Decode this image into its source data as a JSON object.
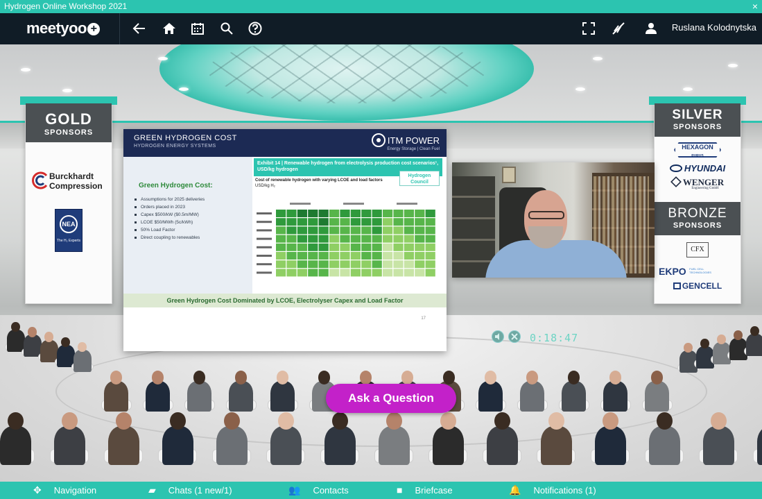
{
  "window": {
    "title": "Hydrogen Online Workshop 2021",
    "close_glyph": "×"
  },
  "nav": {
    "brand": "meetyoo",
    "brand_plus": "+",
    "icons": [
      "back-arrow-icon",
      "home-icon",
      "calendar-icon",
      "search-icon",
      "help-icon",
      "fullscreen-icon",
      "mute-icon",
      "user-icon"
    ],
    "user_name": "Ruslana Kolodnytska"
  },
  "gold_banner": {
    "title": "GOLD",
    "subtitle": "SPONSORS",
    "logos": [
      "Burckhardt",
      "Compression",
      "NEA"
    ],
    "nea_sub": "The H₂ Experts"
  },
  "silver_banner": {
    "title": "SILVER",
    "subtitle": "SPONSORS",
    "logos": [
      "HEXAGON",
      "PURUS",
      "HYUNDAI",
      "WENGER",
      "Engineering GmbH"
    ]
  },
  "bronze_banner": {
    "title": "BRONZE",
    "subtitle": "SPONSORS",
    "logos": [
      "CFX",
      "EKPO",
      "FUEL CELL TECHNOLOGIES",
      "GENCELL"
    ]
  },
  "slide": {
    "title": "GREEN HYDROGEN COST",
    "subtitle": "HYDROGEN ENERGY SYSTEMS",
    "logo": "ITM POWER",
    "logo_sub": "Energy Storage | Clean Fuel",
    "left_title": "Green Hydrogen Cost:",
    "bullets": [
      "Assumptions for 2025 deliveries",
      "Orders placed in 2023",
      "Capex $500/kW ($0.5m/MW)",
      "LCOE $50/MWh (5c/kWh)",
      "50% Load Factor",
      "Direct coupling to renewables"
    ],
    "exhibit": "Exhibit 14 | Renewable hydrogen from electrolysis production cost scenarios¹, USD/kg hydrogen",
    "badge_line1": "Hydrogen",
    "badge_line2": "Council",
    "table_caption": "Cost of renewable hydrogen with varying LCOE and load factors",
    "table_unit": "USD/kg H₂",
    "footer": "Green Hydrogen Cost Dominated by LCOE, Electrolyser Capex and Load Factor",
    "page": "17",
    "heat_rows": 8,
    "heat_cols": 15,
    "heat_colors": [
      "#1e7a31",
      "#2f9a3c",
      "#57b54a",
      "#8fcf64",
      "#c8e4a6",
      "#e7f2d8"
    ]
  },
  "video": {
    "timer": "0:18:47"
  },
  "ask_button": "Ask a Question",
  "bottom_bar": {
    "items": [
      {
        "icon": "navigation-icon",
        "glyph": "✥",
        "label": "Navigation"
      },
      {
        "icon": "chat-icon",
        "glyph": "▰",
        "label": "Chats (1 new/1)"
      },
      {
        "icon": "contacts-icon",
        "glyph": "👥",
        "label": "Contacts"
      },
      {
        "icon": "briefcase-icon",
        "glyph": "■",
        "label": "Briefcase"
      },
      {
        "icon": "bell-icon",
        "glyph": "🔔",
        "label": "Notifications (1)"
      }
    ]
  },
  "colors": {
    "accent": "#2cc4b0",
    "navbar": "#101c26",
    "ask": "#c321c9",
    "slide_header": "#1c2a54"
  }
}
